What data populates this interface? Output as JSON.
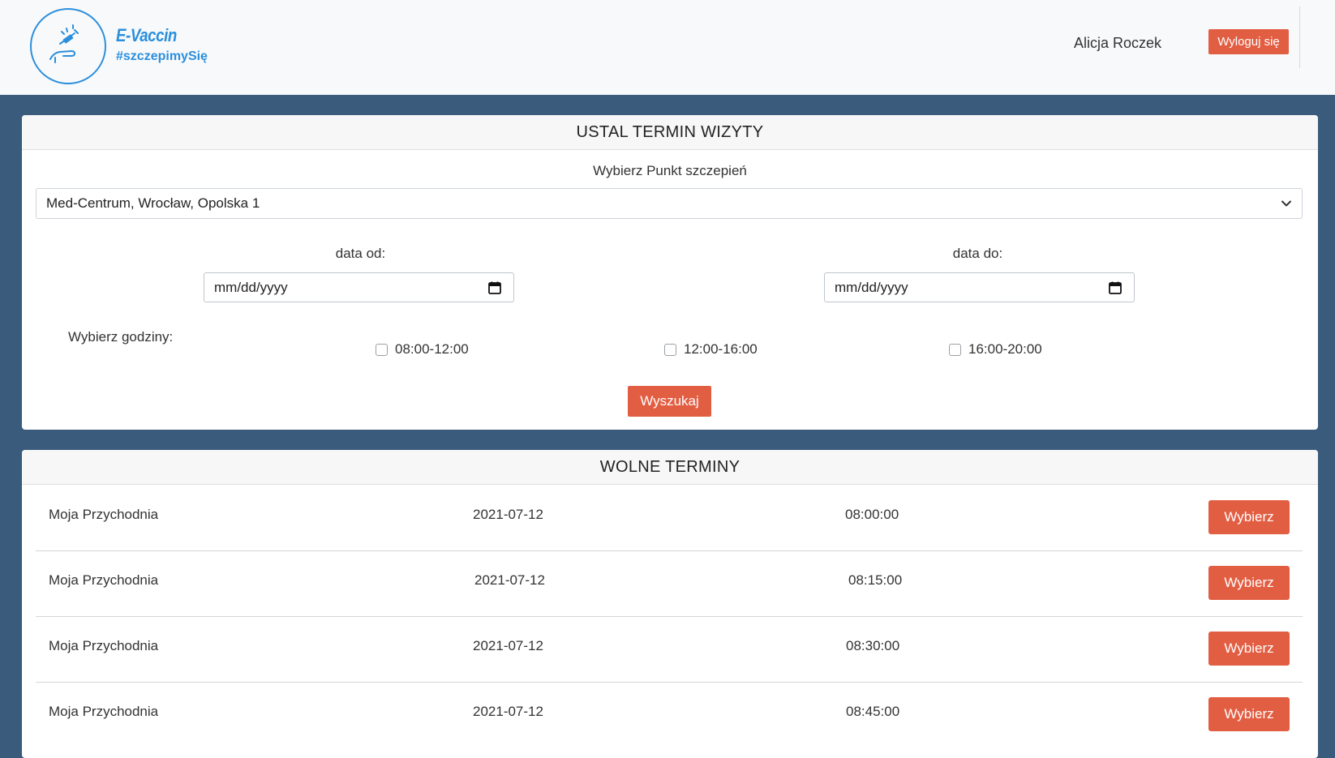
{
  "header": {
    "brand_name": "E-Vaccin",
    "brand_tag": "#szczepimySię",
    "user_name": "Alicja Roczek",
    "logout_label": "Wyloguj się"
  },
  "booking": {
    "title": "USTAL TERMIN WIZYTY",
    "point_label": "Wybierz Punkt szczepień",
    "point_selected": "Med-Centrum, Wrocław, Opolska 1",
    "date_from_label": "data od:",
    "date_from_placeholder": "mm/dd/yyyy",
    "date_to_label": "data do:",
    "date_to_placeholder": "mm/dd/yyyy",
    "hours_label": "Wybierz godziny:",
    "hour_options": [
      "08:00-12:00",
      "12:00-16:00",
      "16:00-20:00"
    ],
    "search_label": "Wyszukaj"
  },
  "slots": {
    "title": "WOLNE TERMINY",
    "choose_label": "Wybierz",
    "rows": [
      {
        "clinic": "Moja Przychodnia",
        "date": "2021-07-12",
        "time": "08:00:00"
      },
      {
        "clinic": "Moja Przychodnia",
        "date": "2021-07-12",
        "time": "08:15:00"
      },
      {
        "clinic": "Moja Przychodnia",
        "date": "2021-07-12",
        "time": "08:30:00"
      },
      {
        "clinic": "Moja Przychodnia",
        "date": "2021-07-12",
        "time": "08:45:00"
      }
    ]
  },
  "colors": {
    "accent": "#e25e43",
    "brand": "#2a8fdd",
    "page_bg": "#3b5b7c"
  }
}
